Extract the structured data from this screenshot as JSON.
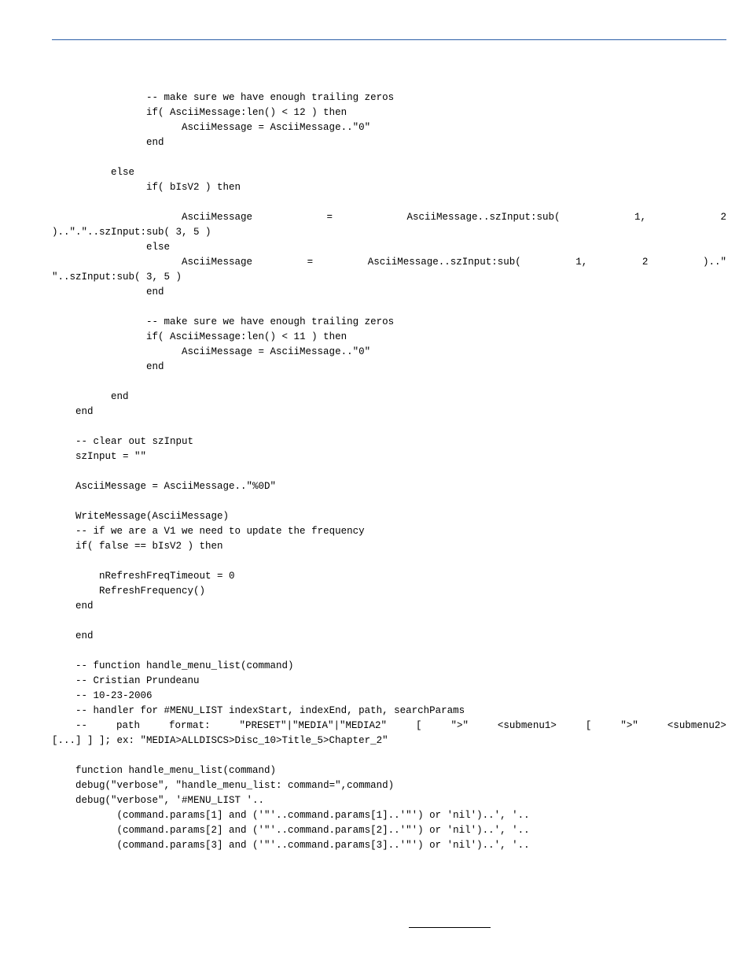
{
  "code_lines": [
    "",
    "                -- make sure we have enough trailing zeros",
    "                if( AsciiMessage:len() < 12 ) then",
    "                      AsciiMessage = AsciiMessage..\"0\"",
    "                end",
    "",
    "          else",
    "                if( bIsV2 ) then",
    "",
    {
      "type": "just",
      "segments": [
        "                      AsciiMessage",
        "=",
        "AsciiMessage..szInput:sub(",
        "1,",
        "2"
      ]
    },
    ")..\".\"..szInput:sub( 3, 5 )",
    "                else",
    {
      "type": "just",
      "segments": [
        "                      AsciiMessage",
        "=",
        "AsciiMessage..szInput:sub(",
        "1,",
        "2",
        ")..\""
      ]
    },
    "\"..szInput:sub( 3, 5 )",
    "                end",
    "",
    "                -- make sure we have enough trailing zeros",
    "                if( AsciiMessage:len() < 11 ) then",
    "                      AsciiMessage = AsciiMessage..\"0\"",
    "                end",
    "",
    "          end",
    "    end",
    "",
    "    -- clear out szInput",
    "    szInput = \"\"",
    "",
    "    AsciiMessage = AsciiMessage..\"%0D\"",
    "",
    "    WriteMessage(AsciiMessage)",
    "    -- if we are a V1 we need to update the frequency",
    "    if( false == bIsV2 ) then",
    "",
    "        nRefreshFreqTimeout = 0",
    "        RefreshFrequency()",
    "    end",
    "",
    "    end",
    "",
    "    -- function handle_menu_list(command)",
    "    -- Cristian Prundeanu",
    "    -- 10-23-2006",
    "    -- handler for #MENU_LIST indexStart, indexEnd, path, searchParams",
    {
      "type": "just",
      "segments": [
        "    --",
        "path",
        "format:",
        "\"PRESET\"|\"MEDIA\"|\"MEDIA2\"",
        "[",
        "\">\"",
        "<submenu1>",
        "[",
        "\">\"",
        "<submenu2>"
      ]
    },
    "[...] ] ]; ex: \"MEDIA>ALLDISCS>Disc_10>Title_5>Chapter_2\"",
    "",
    "    function handle_menu_list(command)",
    "    debug(\"verbose\", \"handle_menu_list: command=\",command)",
    "    debug(\"verbose\", '#MENU_LIST '..",
    "           (command.params[1] and ('\"'..command.params[1]..'\"') or 'nil')..', '..",
    "           (command.params[2] and ('\"'..command.params[2]..'\"') or 'nil')..', '..",
    "           (command.params[3] and ('\"'..command.params[3]..'\"') or 'nil')..', '.."
  ]
}
